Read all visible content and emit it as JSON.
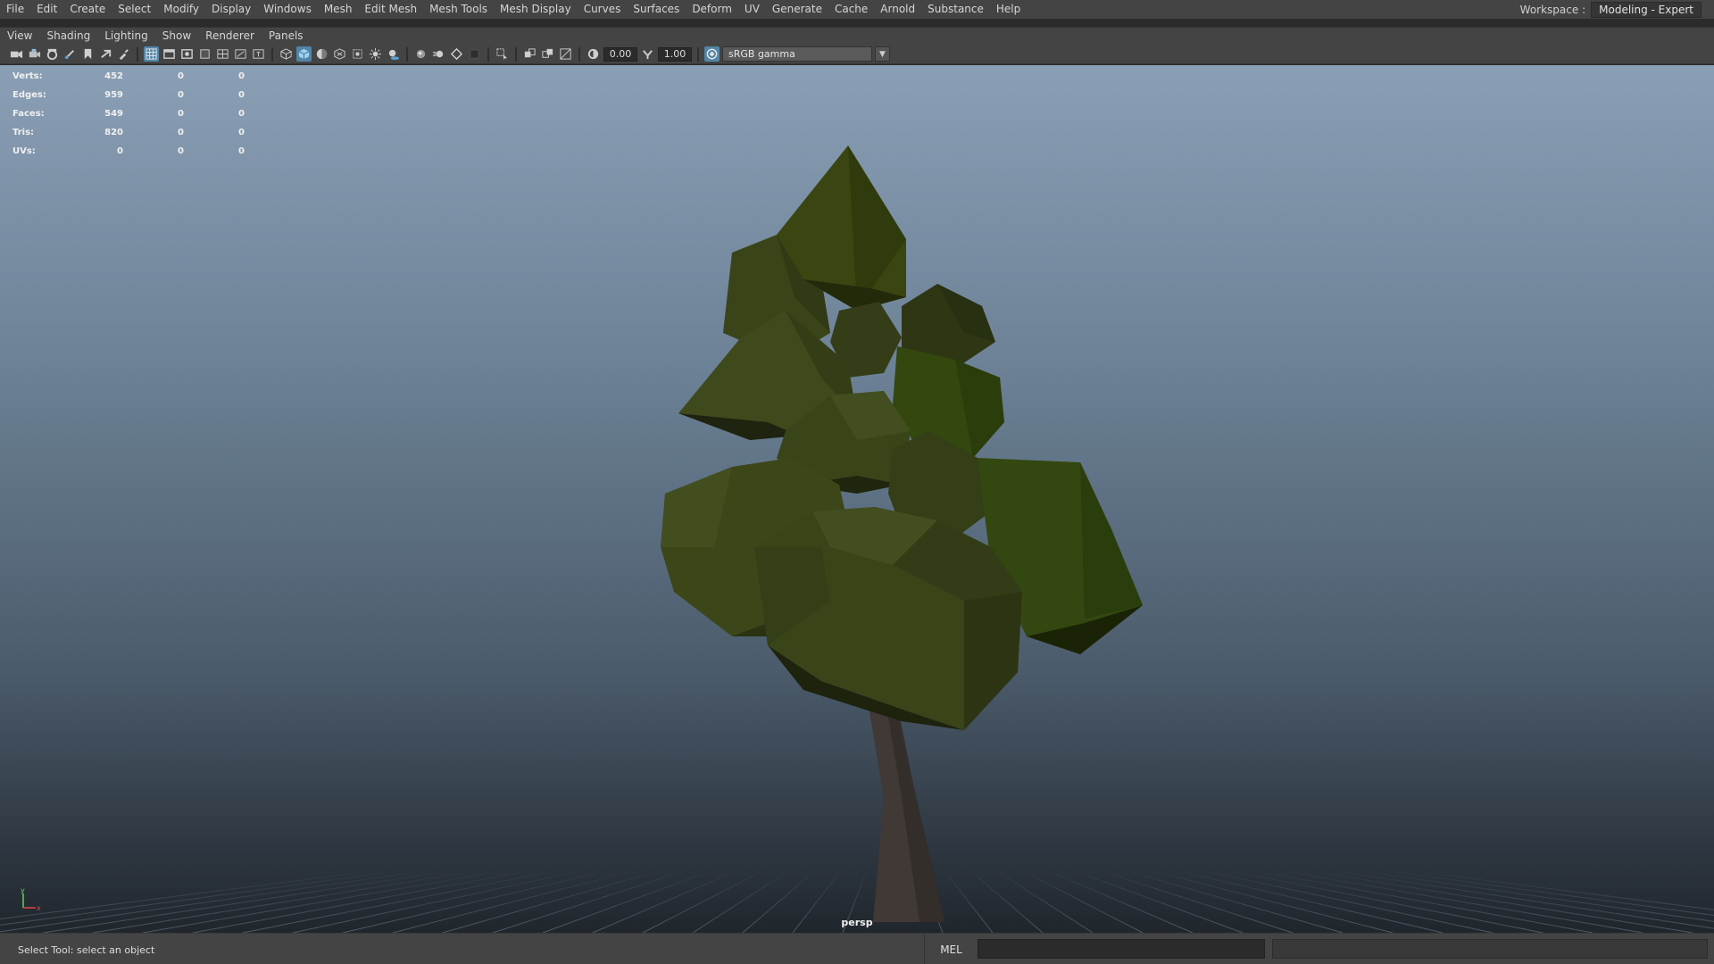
{
  "menubar": {
    "items": [
      "File",
      "Edit",
      "Create",
      "Select",
      "Modify",
      "Display",
      "Windows",
      "Mesh",
      "Edit Mesh",
      "Mesh Tools",
      "Mesh Display",
      "Curves",
      "Surfaces",
      "Deform",
      "UV",
      "Generate",
      "Cache",
      "Arnold",
      "Substance",
      "Help"
    ],
    "workspace_label": "Workspace :",
    "workspace_value": "Modeling - Expert"
  },
  "panel_menu": {
    "items": [
      "View",
      "Shading",
      "Lighting",
      "Show",
      "Renderer",
      "Panels"
    ]
  },
  "toolbar": {
    "exposure": "0.00",
    "gamma": "1.00",
    "color_space": "sRGB gamma",
    "icons": [
      "camera-icon",
      "camera-lock-icon",
      "camera-attrs-icon",
      "pencil-icon",
      "bookmark-icon",
      "image-plane-icon",
      "grease-pencil-icon",
      "grid-icon",
      "film-gate-icon",
      "resolution-gate-icon",
      "gate-mask-icon",
      "field-chart-icon",
      "safe-action-icon",
      "safe-title-icon",
      "wireframe-icon",
      "smooth-shade-icon",
      "default-material-icon",
      "textured-icon",
      "xray-icon",
      "lights-icon",
      "shadows-icon",
      "ambient-occlusion-icon",
      "motion-blur-icon",
      "antialiasing-icon",
      "depth-of-field-icon",
      "isolate-select-icon",
      "xray-joints-icon",
      "xray-active-icon",
      "backface-icon",
      "exposure-icon",
      "gamma-icon",
      "color-management-icon"
    ]
  },
  "hud": {
    "rows": [
      {
        "label": "Verts:",
        "c1": "452",
        "c2": "0",
        "c3": "0"
      },
      {
        "label": "Edges:",
        "c1": "959",
        "c2": "0",
        "c3": "0"
      },
      {
        "label": "Faces:",
        "c1": "549",
        "c2": "0",
        "c3": "0"
      },
      {
        "label": "Tris:",
        "c1": "820",
        "c2": "0",
        "c3": "0"
      },
      {
        "label": "UVs:",
        "c1": "0",
        "c2": "0",
        "c3": "0"
      }
    ]
  },
  "viewport": {
    "camera": "persp",
    "axis_y": "y",
    "axis_x": "x",
    "colors": {
      "leaf": "#3f4a1c",
      "leaf_bright": "#3a5210",
      "trunk": "#403935",
      "sky_top": "#8a9fb5",
      "sky_bottom": "#20262c"
    }
  },
  "statusbar": {
    "help_line": "Select Tool: select an object",
    "mel_label": "MEL"
  }
}
